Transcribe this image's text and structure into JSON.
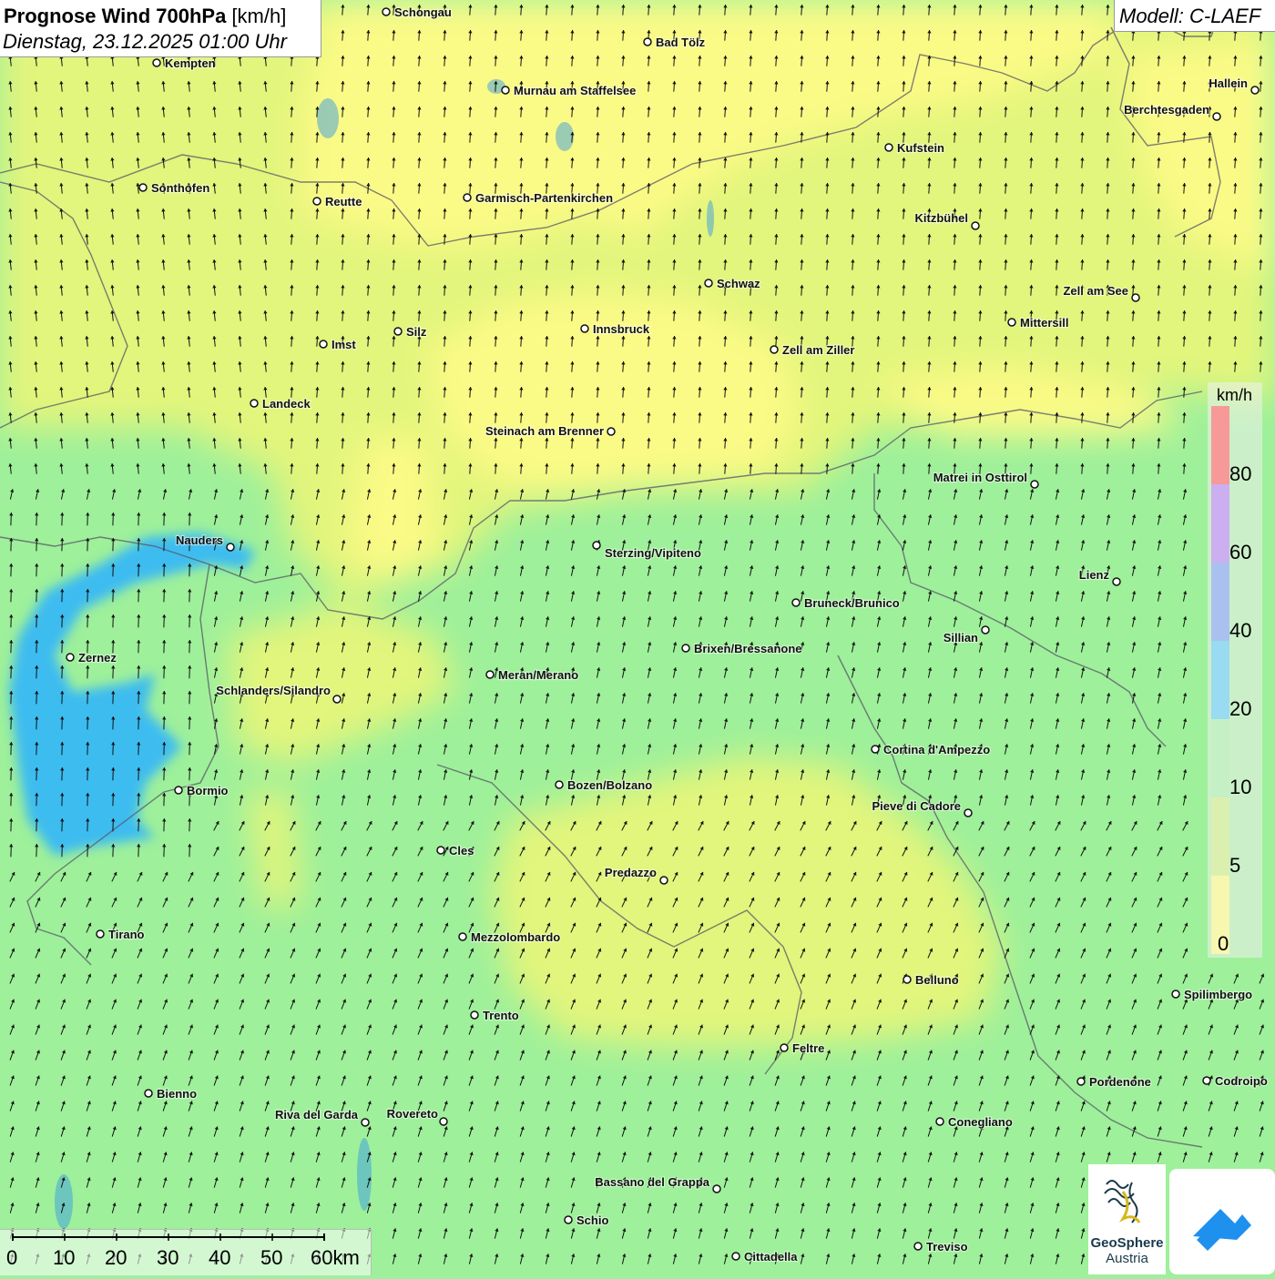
{
  "title": {
    "bold": "Prognose Wind 700hPa",
    "unit": " [km/h]",
    "date": "Dienstag, 23.12.2025 01:00 Uhr"
  },
  "model": "Modell: C-LAEF",
  "legend": {
    "unit": "km/h",
    "labels": [
      "80",
      "60",
      "40",
      "20",
      "10",
      "5",
      "0"
    ],
    "colors": [
      "#ff3030",
      "#a060f0",
      "#5588f0",
      "#30c0f0",
      "#90ee90",
      "#c0f060",
      "#ffff60"
    ]
  },
  "scale": {
    "labels": [
      "0",
      "10",
      "20",
      "30",
      "40",
      "50",
      "60km"
    ]
  },
  "logo": {
    "line1": "GeoSphere",
    "line2": "Austria"
  },
  "wind": {
    "direction": "from south / south-southwest",
    "field_colors": [
      "#ffff80",
      "#e8f87a",
      "#9ef09a",
      "#3cbcf0"
    ]
  },
  "cities": [
    {
      "name": "Schongau"
    },
    {
      "name": "Bad Tölz"
    },
    {
      "name": "Kempten"
    },
    {
      "name": "Murnau am Staffelsee"
    },
    {
      "name": "Hallein"
    },
    {
      "name": "Berchtesgaden"
    },
    {
      "name": "Kufstein"
    },
    {
      "name": "Sonthofen"
    },
    {
      "name": "Reutte"
    },
    {
      "name": "Garmisch-Partenkirchen"
    },
    {
      "name": "Kitzbühel"
    },
    {
      "name": "Schwaz"
    },
    {
      "name": "Zell am See"
    },
    {
      "name": "Mittersill"
    },
    {
      "name": "Innsbruck"
    },
    {
      "name": "Silz"
    },
    {
      "name": "Imst"
    },
    {
      "name": "Zell am Ziller"
    },
    {
      "name": "Landeck"
    },
    {
      "name": "Steinach am Brenner"
    },
    {
      "name": "Matrei in Osttirol"
    },
    {
      "name": "Nauders"
    },
    {
      "name": "Sterzing/Vipiteno"
    },
    {
      "name": "Lienz"
    },
    {
      "name": "Bruneck/Brunico"
    },
    {
      "name": "Sillian"
    },
    {
      "name": "Zernez"
    },
    {
      "name": "Brixen/Bressanone"
    },
    {
      "name": "Meran/Merano"
    },
    {
      "name": "Schlanders/Silandro"
    },
    {
      "name": "Cortina d'Ampezzo"
    },
    {
      "name": "Bozen/Bolzano"
    },
    {
      "name": "Bormio"
    },
    {
      "name": "Pieve di Cadore"
    },
    {
      "name": "Cles"
    },
    {
      "name": "Predazzo"
    },
    {
      "name": "Tirano"
    },
    {
      "name": "Mezzolombardo"
    },
    {
      "name": "Belluno"
    },
    {
      "name": "Spilimbergo"
    },
    {
      "name": "Trento"
    },
    {
      "name": "Feltre"
    },
    {
      "name": "Pordenone"
    },
    {
      "name": "Codroipo"
    },
    {
      "name": "Bienno"
    },
    {
      "name": "Riva del Garda"
    },
    {
      "name": "Rovereto"
    },
    {
      "name": "Conegliano"
    },
    {
      "name": "Bassano del Grappa"
    },
    {
      "name": "Schio"
    },
    {
      "name": "Treviso"
    },
    {
      "name": "Cittadella"
    }
  ]
}
